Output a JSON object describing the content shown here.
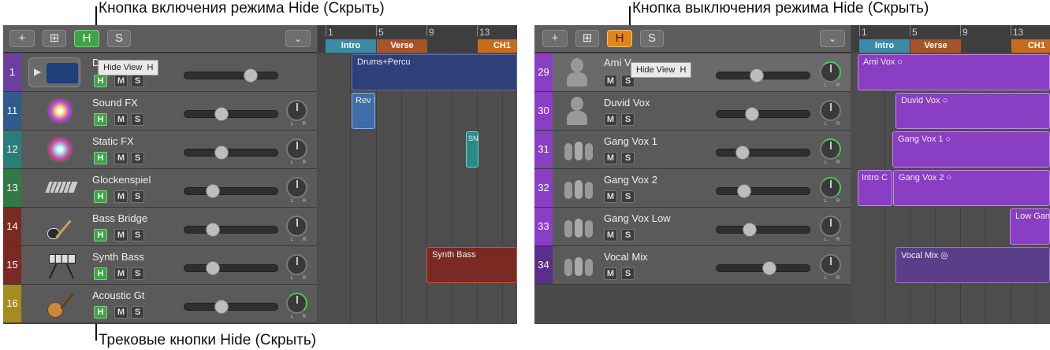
{
  "captions": {
    "top_left": "Кнопка включения режима Hide (Скрыть)",
    "top_right": "Кнопка выключения режима Hide (Скрыть)",
    "bottom": "Трековые кнопки Hide (Скрыть)"
  },
  "toolbar": {
    "add": "+",
    "duplicate": "⊞",
    "hide": "H",
    "solo": "S",
    "menu": "⌄"
  },
  "tooltip": {
    "label": "Hide View",
    "key": "H"
  },
  "ruler": {
    "bars": [
      "1",
      "5",
      "9",
      "13"
    ]
  },
  "markers": {
    "intro": "Intro",
    "verse": "Verse",
    "chorus": "CH1"
  },
  "knob_lr": {
    "l": "L",
    "r": "R"
  },
  "buttons": {
    "h": "H",
    "m": "M",
    "s": "S"
  },
  "left": {
    "tracks": [
      {
        "num": "1",
        "name": "D",
        "color": "#6a3fa0"
      },
      {
        "num": "11",
        "name": "Sound FX",
        "color": "#2f5c8c"
      },
      {
        "num": "12",
        "name": "Static FX",
        "color": "#2a7e7a"
      },
      {
        "num": "13",
        "name": "Glockenspiel",
        "color": "#2f7a45"
      },
      {
        "num": "14",
        "name": "Bass Bridge",
        "color": "#7a2a22"
      },
      {
        "num": "15",
        "name": "Synth Bass",
        "color": "#7a2a22"
      },
      {
        "num": "16",
        "name": "Acoustic Gt",
        "color": "#a88b1f"
      }
    ],
    "regions": {
      "drums": "Drums+Percu",
      "rev": "Rev S",
      "static": "SN",
      "synth": "Synth Bass"
    }
  },
  "right": {
    "tracks": [
      {
        "num": "29",
        "name": "Ami V"
      },
      {
        "num": "30",
        "name": "Duvid Vox"
      },
      {
        "num": "31",
        "name": "Gang Vox 1"
      },
      {
        "num": "32",
        "name": "Gang Vox 2"
      },
      {
        "num": "33",
        "name": "Gang Vox Low"
      },
      {
        "num": "34",
        "name": "Vocal Mix"
      }
    ],
    "regions": {
      "ami": "Ami Vox",
      "duvid": "Duvid Vox",
      "gang1": "Gang Vox 1",
      "intro_c": "Intro C",
      "gang2": "Gang Vox 2",
      "low": "Low Gan",
      "mix": "Vocal Mix"
    },
    "track_color": "#8a3ec4"
  }
}
